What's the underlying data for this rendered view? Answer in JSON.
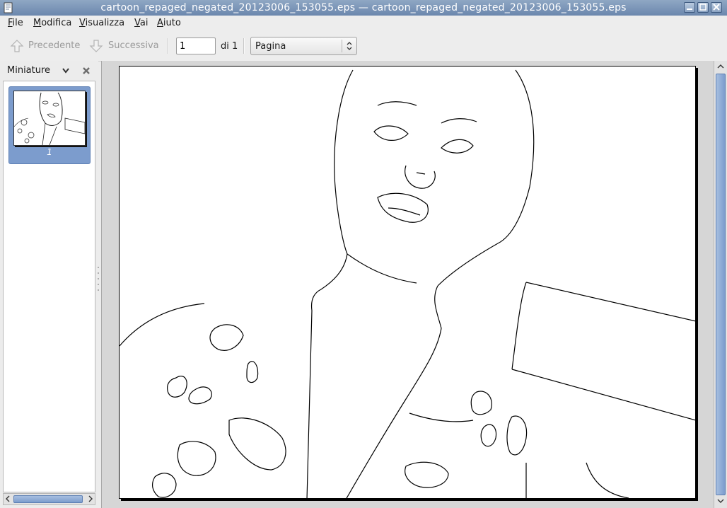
{
  "window": {
    "title": "cartoon_repaged_negated_20123006_153055.eps — cartoon_repaged_negated_20123006_153055.eps"
  },
  "menubar": {
    "items": [
      {
        "label": "File",
        "accel": "F",
        "rest": "ile"
      },
      {
        "label": "Modifica",
        "accel": "M",
        "rest": "odifica"
      },
      {
        "label": "Visualizza",
        "accel": "V",
        "rest": "isualizza"
      },
      {
        "label": "Vai",
        "accel": "V",
        "rest": "ai"
      },
      {
        "label": "Aiuto",
        "accel": "A",
        "rest": "iuto"
      }
    ]
  },
  "toolbar": {
    "prev_label": "Precedente",
    "next_label": "Successiva",
    "page_value": "1",
    "page_of": "di 1",
    "zoom_value": "Pagina"
  },
  "sidebar": {
    "title": "Miniature",
    "thumbnails": [
      {
        "page_label": "1"
      }
    ]
  },
  "icons": {
    "prev": "arrow-up-icon",
    "next": "arrow-down-icon",
    "sidebar_menu": "chevron-down-icon",
    "sidebar_close": "close-icon"
  }
}
